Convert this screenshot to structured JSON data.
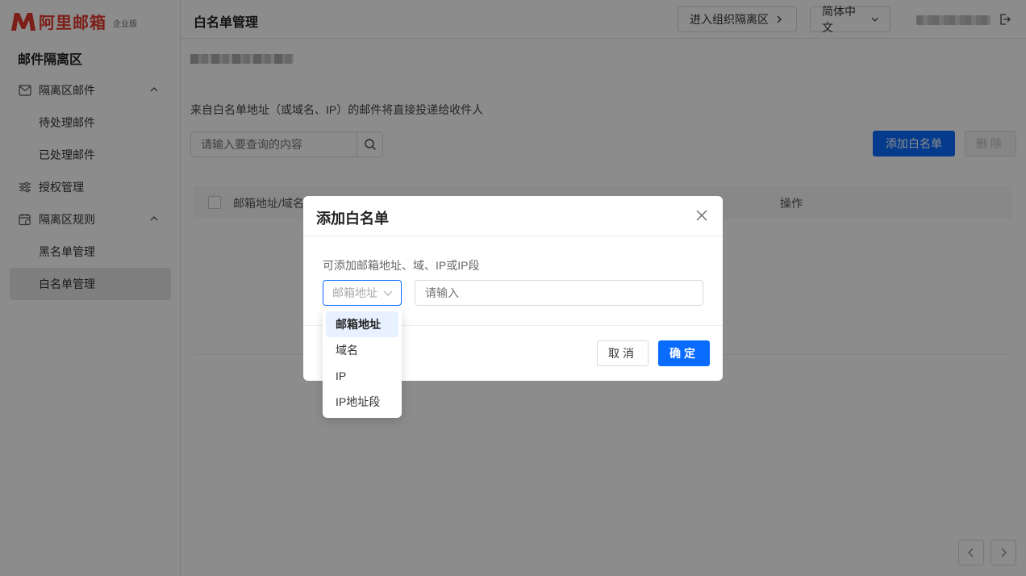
{
  "brand": {
    "name": "阿里邮箱",
    "edition": "企业版"
  },
  "sidebar": {
    "title": "邮件隔离区",
    "items": [
      {
        "label": "隔离区邮件"
      },
      {
        "label": "待处理邮件"
      },
      {
        "label": "已处理邮件"
      },
      {
        "label": "授权管理"
      },
      {
        "label": "隔离区规则"
      },
      {
        "label": "黑名单管理"
      },
      {
        "label": "白名单管理"
      }
    ]
  },
  "header": {
    "title": "白名单管理",
    "org_button": "进入组织隔离区",
    "language": "简体中文"
  },
  "main": {
    "description": "来自白名单地址（或域名、IP）的邮件将直接投递给收件人",
    "search_placeholder": "请输入要查询的内容",
    "add_button": "添加白名单",
    "delete_button": "删除",
    "table": {
      "columns": [
        "邮箱地址/域名",
        "操作"
      ]
    }
  },
  "modal": {
    "title": "添加白名单",
    "hint": "可添加邮箱地址、域、IP或IP段",
    "select_value": "邮箱地址",
    "input_placeholder": "请输入",
    "cancel": "取消",
    "confirm": "确定"
  },
  "dropdown": {
    "options": [
      "邮箱地址",
      "域名",
      "IP",
      "IP地址段"
    ],
    "selected_index": 0
  },
  "colors": {
    "primary": "#0a6cff",
    "brand_red": "#e33a2f"
  }
}
